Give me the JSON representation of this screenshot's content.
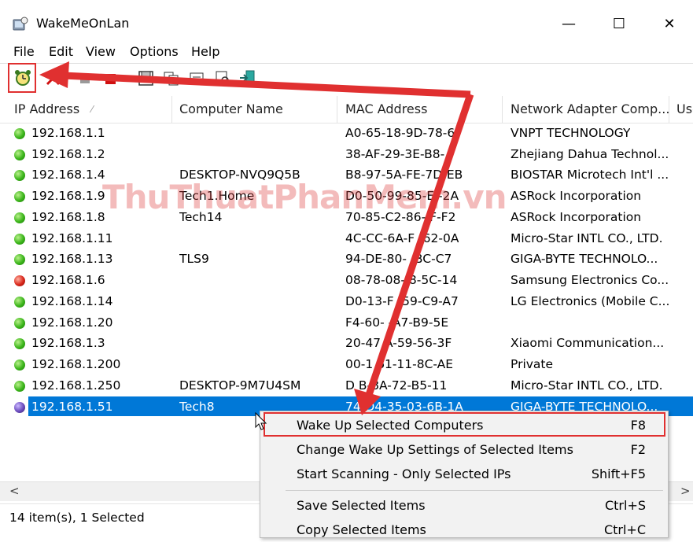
{
  "window": {
    "title": "WakeMeOnLan",
    "minimize_glyph": "—",
    "maximize_glyph": "☐",
    "close_glyph": "✕"
  },
  "menu": [
    "File",
    "Edit",
    "View",
    "Options",
    "Help"
  ],
  "toolbar": {
    "buttons": [
      "wake-up-icon",
      "delete-icon",
      "stop-icon",
      "stop-red-icon",
      "save-icon",
      "copy-icon",
      "properties-icon",
      "find-icon",
      "exit-icon"
    ]
  },
  "columns": [
    {
      "label": "IP Address",
      "sort_glyph": "⁄"
    },
    {
      "label": "Computer Name"
    },
    {
      "label": "MAC Address"
    },
    {
      "label": "Network Adapter Comp..."
    },
    {
      "label": "Use"
    }
  ],
  "rows": [
    {
      "status": "green",
      "ip": "192.168.1.1",
      "name": "",
      "mac": "A0-65-18-9D-78-6",
      "vendor": "VNPT TECHNOLOGY"
    },
    {
      "status": "green",
      "ip": "192.168.1.2",
      "name": "",
      "mac": "38-AF-29-3E-B8-",
      "vendor": "Zhejiang Dahua Technol..."
    },
    {
      "status": "green",
      "ip": "192.168.1.4",
      "name": "DESKTOP-NVQ9Q5B",
      "mac": "B8-97-5A-FE-7D-EB",
      "vendor": "BIOSTAR Microtech Int'l ..."
    },
    {
      "status": "green",
      "ip": "192.168.1.9",
      "name": "Tech1.Home",
      "mac": "D0-50-99-85-E -2A",
      "vendor": "ASRock Incorporation"
    },
    {
      "status": "green",
      "ip": "192.168.1.8",
      "name": "Tech14",
      "mac": "70-85-C2-86-  F-F2",
      "vendor": "ASRock Incorporation"
    },
    {
      "status": "green",
      "ip": "192.168.1.11",
      "name": "",
      "mac": "4C-CC-6A-F  -62-0A",
      "vendor": "Micro-Star INTL CO., LTD."
    },
    {
      "status": "green",
      "ip": "192.168.1.13",
      "name": "TLS9",
      "mac": "94-DE-80-  -BC-C7",
      "vendor": "GIGA-BYTE TECHNOLO..."
    },
    {
      "status": "red",
      "ip": "192.168.1.6",
      "name": "",
      "mac": "08-78-08-  8-5C-14",
      "vendor": "Samsung Electronics Co..."
    },
    {
      "status": "green",
      "ip": "192.168.1.14",
      "name": "",
      "mac": "D0-13-F  -59-C9-A7",
      "vendor": "LG Electronics (Mobile C..."
    },
    {
      "status": "green",
      "ip": "192.168.1.20",
      "name": "",
      "mac": "F4-60-  -A7-B9-5E",
      "vendor": ""
    },
    {
      "status": "green",
      "ip": "192.168.1.3",
      "name": "",
      "mac": "20-47  A-59-56-3F",
      "vendor": "Xiaomi Communication..."
    },
    {
      "status": "green",
      "ip": "192.168.1.200",
      "name": "",
      "mac": "00-1  61-11-8C-AE",
      "vendor": "Private"
    },
    {
      "status": "green",
      "ip": "192.168.1.250",
      "name": "DESKTOP-9M7U4SM",
      "mac": "D  B-8A-72-B5-11",
      "vendor": "Micro-Star INTL CO., LTD."
    },
    {
      "status": "purple",
      "ip": "192.168.1.51",
      "name": "Tech8",
      "mac": "74-D4-35-03-6B-1A",
      "vendor": "GIGA-BYTE TECHNOLO...",
      "selected": true
    }
  ],
  "context_menu": [
    {
      "label": "Wake Up Selected Computers",
      "shortcut": "F8",
      "highlighted": true
    },
    {
      "label": "Change Wake Up Settings of Selected Items",
      "shortcut": "F2"
    },
    {
      "label": "Start Scanning - Only Selected IPs",
      "shortcut": "Shift+F5"
    },
    {
      "separator": true
    },
    {
      "label": "Save Selected Items",
      "shortcut": "Ctrl+S"
    },
    {
      "label": "Copy Selected Items",
      "shortcut": "Ctrl+C"
    }
  ],
  "scrollbar": {
    "left_glyph": "<",
    "right_glyph": ">"
  },
  "status": {
    "text": "14 item(s), 1 Selected"
  },
  "watermark": {
    "text": "ThuThuatPhanMem.vn"
  },
  "colors": {
    "selection": "#0078d7",
    "annotation": "#e03030"
  }
}
